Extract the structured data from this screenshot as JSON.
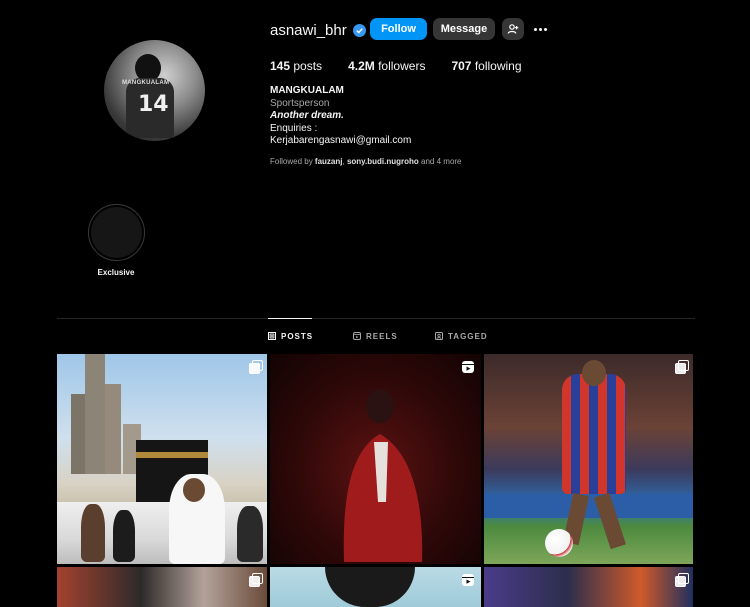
{
  "profile": {
    "username": "asnawi_bhr",
    "follow_label": "Follow",
    "message_label": "Message",
    "stats": {
      "posts_count": "145",
      "posts_label": "posts",
      "followers_count": "4.2M",
      "followers_label": "followers",
      "following_count": "707",
      "following_label": "following"
    },
    "bio": {
      "full_name": "MANGKUALAM",
      "category": "Sportsperson",
      "tagline": "Another dream.",
      "line1": "Enquiries :",
      "line2": "Kerjabarengasnawi@gmail.com"
    },
    "followed_by": {
      "prefix": "Followed by",
      "user1": "fauzanj",
      "separator": ",",
      "user2": "sony.budi.nugroho",
      "suffix": "and 4 more"
    },
    "avatar_jersey_text": "MANGKUALAM",
    "avatar_jersey_number": "14"
  },
  "highlights": [
    {
      "label": "Exclusive"
    }
  ],
  "tabs": [
    {
      "label": "POSTS",
      "icon": "grid-icon",
      "active": true
    },
    {
      "label": "REELS",
      "icon": "reels-icon",
      "active": false
    },
    {
      "label": "TAGGED",
      "icon": "tagged-icon",
      "active": false
    }
  ],
  "posts": [
    {
      "type": "carousel",
      "subject": "kaaba-pilgrimage"
    },
    {
      "type": "reel",
      "subject": "red-cloak-portrait"
    },
    {
      "type": "carousel",
      "subject": "match-action-ball"
    },
    {
      "type": "carousel",
      "subject": "celebration"
    },
    {
      "type": "reel",
      "subject": "sky-portrait"
    },
    {
      "type": "carousel",
      "subject": "team-celebration"
    }
  ],
  "colors": {
    "background": "#000000",
    "follow_button": "#0095f6",
    "secondary_button": "#363636",
    "verified_badge": "#3897f0",
    "muted_text": "#a8a8a8"
  }
}
